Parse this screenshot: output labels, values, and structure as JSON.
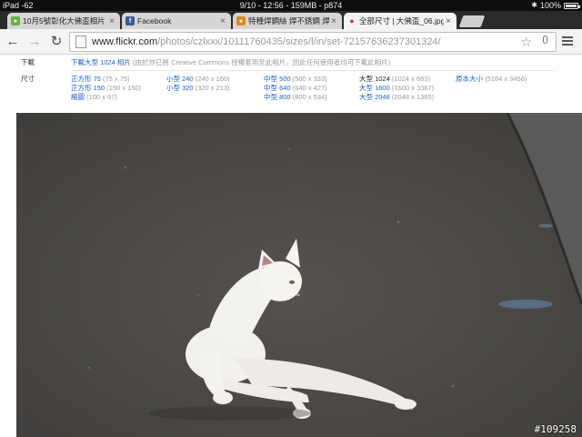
{
  "statusbar": {
    "device": "iPad -62",
    "center": "9/10 - 12:56 - 159MB - p874",
    "battery": "100%"
  },
  "tabs": [
    {
      "label": "10月5號彰化大佛盃相片 ...",
      "favicon_color": "#6ab04c"
    },
    {
      "label": "Facebook",
      "favicon_color": "#3b5998"
    },
    {
      "label": "特種焊鋼絲 焊不銹鋼 焊鋁 ...",
      "favicon_color": "#e08a1e"
    },
    {
      "label": "全部尺寸 | 大佛盃_06.jpg |",
      "favicon_color": "#e0297a"
    }
  ],
  "toolbar": {
    "url_host": "www.flickr.com",
    "url_path": "/photos/czlxxx/10111760435/sizes/l/in/set-72157636237301324/"
  },
  "download": {
    "label": "下載",
    "link": "下載大型 1024 相片",
    "note": "(由於你已將 Creative Commons 授權套用至此相片，因此任何使用者均可下載此相片)"
  },
  "sizes": {
    "label": "尺寸",
    "items": [
      {
        "name": "正方形 75",
        "dim": "(75 x 75)",
        "current": false
      },
      {
        "name": "正方形 150",
        "dim": "(150 x 150)",
        "current": false
      },
      {
        "name": "縮圖",
        "dim": "(100 x 67)",
        "current": false
      },
      {
        "name": "小型 240",
        "dim": "(240 x 160)",
        "current": false
      },
      {
        "name": "小型 320",
        "dim": "(320 x 213)",
        "current": false
      },
      {
        "name": "中型 500",
        "dim": "(500 x 333)",
        "current": false
      },
      {
        "name": "中型 640",
        "dim": "(640 x 427)",
        "current": false
      },
      {
        "name": "中型 800",
        "dim": "(800 x 534)",
        "current": false
      },
      {
        "name": "大型 1024",
        "dim": "(1024 x 683)",
        "current": true
      },
      {
        "name": "大型 1600",
        "dim": "(1600 x 1067)",
        "current": false
      },
      {
        "name": "大型 2048",
        "dim": "(2048 x 1365)",
        "current": false
      },
      {
        "name": "原本大小",
        "dim": "(5184 x 3456)",
        "current": false
      }
    ]
  },
  "watermark": "#109258",
  "colors": {
    "link": "#2063c7",
    "road": "#4a4846"
  }
}
